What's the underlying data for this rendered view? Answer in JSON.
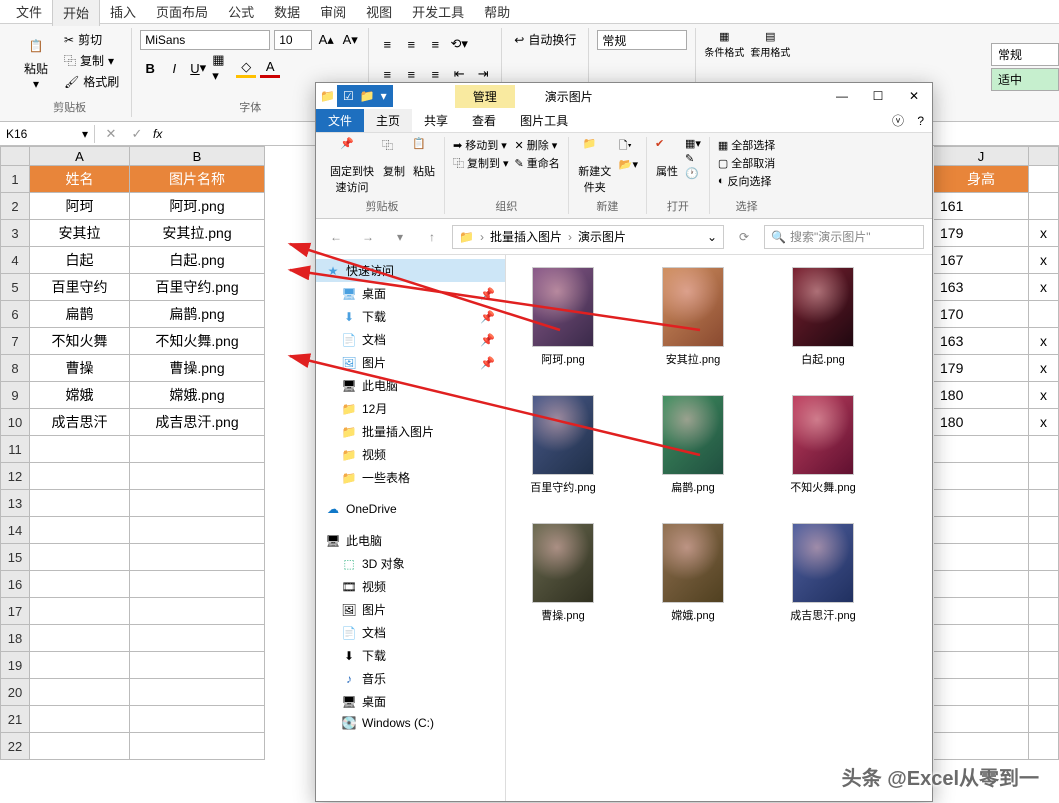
{
  "excel": {
    "menus": [
      "文件",
      "开始",
      "插入",
      "页面布局",
      "公式",
      "数据",
      "审阅",
      "视图",
      "开发工具",
      "帮助"
    ],
    "active_menu": "开始",
    "clipboard": {
      "paste": "粘贴",
      "cut": "剪切",
      "copy": "复制",
      "format_painter": "格式刷",
      "label": "剪贴板"
    },
    "font": {
      "name": "MiSans",
      "size": "10",
      "label": "字体"
    },
    "alignment": {
      "wrap": "自动换行"
    },
    "number": {
      "format": "常规"
    },
    "styles": {
      "rule": "条件格式",
      "format": "套用格式",
      "dropdown": "常规",
      "opt": "适中"
    },
    "namebox": "K16",
    "fx": "fx",
    "columns": {
      "A": "A",
      "B": "B",
      "J": "J"
    },
    "headers": {
      "name": "姓名",
      "img": "图片名称",
      "height": "身高"
    },
    "rows": [
      {
        "n": "1",
        "name": "姓名",
        "img": "图片名称",
        "h": "身高",
        "hdr": true
      },
      {
        "n": "2",
        "name": "阿珂",
        "img": "阿珂.png",
        "h": "161"
      },
      {
        "n": "3",
        "name": "安其拉",
        "img": "安其拉.png",
        "h": "179",
        "x": "x"
      },
      {
        "n": "4",
        "name": "白起",
        "img": "白起.png",
        "h": "167",
        "x": "x"
      },
      {
        "n": "5",
        "name": "百里守约",
        "img": "百里守约.png",
        "h": "163",
        "x": "x"
      },
      {
        "n": "6",
        "name": "扁鹊",
        "img": "扁鹊.png",
        "h": "170"
      },
      {
        "n": "7",
        "name": "不知火舞",
        "img": "不知火舞.png",
        "h": "163",
        "x": "x"
      },
      {
        "n": "8",
        "name": "曹操",
        "img": "曹操.png",
        "h": "179",
        "x": "x"
      },
      {
        "n": "9",
        "name": "嫦娥",
        "img": "嫦娥.png",
        "h": "180",
        "x": "x"
      },
      {
        "n": "10",
        "name": "成吉思汗",
        "img": "成吉思汗.png",
        "h": "180",
        "x": "x"
      },
      {
        "n": "11"
      },
      {
        "n": "12"
      },
      {
        "n": "13"
      },
      {
        "n": "14"
      },
      {
        "n": "15"
      },
      {
        "n": "16"
      },
      {
        "n": "17"
      },
      {
        "n": "18"
      },
      {
        "n": "19"
      },
      {
        "n": "20"
      },
      {
        "n": "21"
      },
      {
        "n": "22"
      }
    ]
  },
  "explorer": {
    "manage": "管理",
    "title": "演示图片",
    "tabs": {
      "file": "文件",
      "home": "主页",
      "share": "共享",
      "view": "查看",
      "imgtools": "图片工具"
    },
    "ribbon": {
      "pin": "固定到快速访问",
      "copy": "复制",
      "paste": "粘贴",
      "clip_label": "剪贴板",
      "moveto": "移动到",
      "copyto": "复制到",
      "delete": "删除",
      "rename": "重命名",
      "org_label": "组织",
      "newfolder": "新建文件夹",
      "new_label": "新建",
      "props": "属性",
      "open_label": "打开",
      "selall": "全部选择",
      "selnone": "全部取消",
      "selinv": "反向选择",
      "sel_label": "选择"
    },
    "breadcrumb": [
      "批量插入图片",
      "演示图片"
    ],
    "search_placeholder": "搜索\"演示图片\"",
    "nav": {
      "quick": "快速访问",
      "desktop": "桌面",
      "downloads": "下载",
      "documents": "文档",
      "pictures": "图片",
      "thispc": "此电脑",
      "dec": "12月",
      "batch": "批量插入图片",
      "videos": "视频",
      "sometables": "一些表格",
      "onedrive": "OneDrive",
      "pc": "此电脑",
      "3d": "3D 对象",
      "vids": "视频",
      "pics": "图片",
      "docs": "文档",
      "dl": "下载",
      "music": "音乐",
      "desk": "桌面",
      "cdrive": "Windows (C:)"
    },
    "files": [
      {
        "name": "阿珂.png"
      },
      {
        "name": "安其拉.png"
      },
      {
        "name": "白起.png"
      },
      {
        "name": "百里守约.png"
      },
      {
        "name": "扁鹊.png"
      },
      {
        "name": "不知火舞.png"
      },
      {
        "name": "曹操.png"
      },
      {
        "name": "嫦娥.png"
      },
      {
        "name": "成吉思汗.png"
      }
    ]
  },
  "watermark": "头条 @Excel从零到一"
}
